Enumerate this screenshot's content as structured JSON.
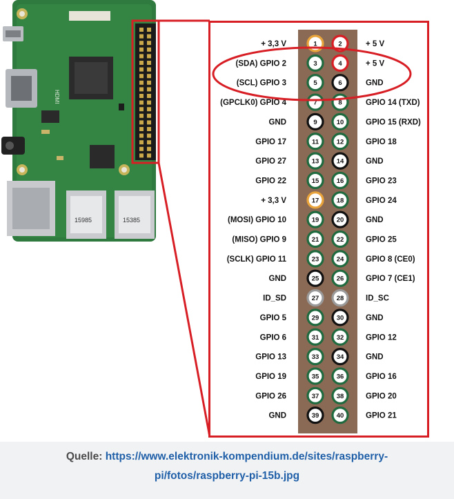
{
  "colors": {
    "frame": "#d81e25",
    "header": "#8a6a55",
    "pin_power33": "#e8a33a",
    "pin_power5": "#d81e25",
    "pin_ground": "#111111",
    "pin_gpio": "#1f6b3f",
    "pin_idsc": "#9a9a9a",
    "link": "#1f5fa8"
  },
  "pins": [
    {
      "n": "1",
      "type": "power33"
    },
    {
      "n": "2",
      "type": "power5"
    },
    {
      "n": "3",
      "type": "gpio"
    },
    {
      "n": "4",
      "type": "power5"
    },
    {
      "n": "5",
      "type": "gpio"
    },
    {
      "n": "6",
      "type": "ground"
    },
    {
      "n": "7",
      "type": "gpio"
    },
    {
      "n": "8",
      "type": "gpio"
    },
    {
      "n": "9",
      "type": "ground"
    },
    {
      "n": "10",
      "type": "gpio"
    },
    {
      "n": "11",
      "type": "gpio"
    },
    {
      "n": "12",
      "type": "gpio"
    },
    {
      "n": "13",
      "type": "gpio"
    },
    {
      "n": "14",
      "type": "ground"
    },
    {
      "n": "15",
      "type": "gpio"
    },
    {
      "n": "16",
      "type": "gpio"
    },
    {
      "n": "17",
      "type": "power33"
    },
    {
      "n": "18",
      "type": "gpio"
    },
    {
      "n": "19",
      "type": "gpio"
    },
    {
      "n": "20",
      "type": "ground"
    },
    {
      "n": "21",
      "type": "gpio"
    },
    {
      "n": "22",
      "type": "gpio"
    },
    {
      "n": "23",
      "type": "gpio"
    },
    {
      "n": "24",
      "type": "gpio"
    },
    {
      "n": "25",
      "type": "ground"
    },
    {
      "n": "26",
      "type": "gpio"
    },
    {
      "n": "27",
      "type": "idsc"
    },
    {
      "n": "28",
      "type": "idsc"
    },
    {
      "n": "29",
      "type": "gpio"
    },
    {
      "n": "30",
      "type": "ground"
    },
    {
      "n": "31",
      "type": "gpio"
    },
    {
      "n": "32",
      "type": "gpio"
    },
    {
      "n": "33",
      "type": "gpio"
    },
    {
      "n": "34",
      "type": "ground"
    },
    {
      "n": "35",
      "type": "gpio"
    },
    {
      "n": "36",
      "type": "gpio"
    },
    {
      "n": "37",
      "type": "gpio"
    },
    {
      "n": "38",
      "type": "gpio"
    },
    {
      "n": "39",
      "type": "ground"
    },
    {
      "n": "40",
      "type": "gpio"
    }
  ],
  "left_labels": [
    "+ 3,3 V",
    "(SDA) GPIO 2",
    "(SCL) GPIO 3",
    "(GPCLK0) GPIO 4",
    "GND",
    "GPIO 17",
    "GPIO 27",
    "GPIO 22",
    "+ 3,3 V",
    "(MOSI) GPIO 10",
    "(MISO) GPIO 9",
    "(SCLK) GPIO 11",
    "GND",
    "ID_SD",
    "GPIO 5",
    "GPIO 6",
    "GPIO 13",
    "GPIO 19",
    "GPIO 26",
    "GND"
  ],
  "right_labels": [
    "+ 5 V",
    "+ 5 V",
    "GND",
    "GPIO 14 (TXD)",
    "GPIO 15 (RXD)",
    "GPIO 18",
    "GND",
    "GPIO 23",
    "GPIO 24",
    "GND",
    "GPIO 25",
    "GPIO 8 (CE0)",
    "GPIO 7 (CE1)",
    "ID_SC",
    "GND",
    "GPIO 12",
    "GND",
    "GPIO 16",
    "GPIO 20",
    "GPIO 21"
  ],
  "board": {
    "chip_labels": [
      "15985",
      "15385"
    ],
    "hdmi_label": "HDMI"
  },
  "caption": {
    "prefix": "Quelle:",
    "link_line1": "https://www.elektronik-kompendium.de/sites/raspberry-",
    "link_line2": "pi/fotos/raspberry-pi-15b.jpg"
  }
}
